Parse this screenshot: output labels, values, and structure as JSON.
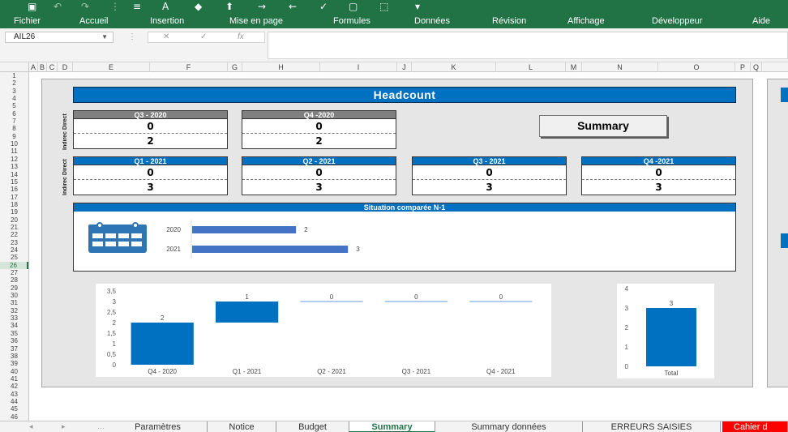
{
  "ribbon": {
    "menu": [
      "Fichier",
      "Accueil",
      "Insertion",
      "Mise en page",
      "Formules",
      "Données",
      "Révision",
      "Affichage",
      "Développeur",
      "Aide"
    ]
  },
  "formula_bar": {
    "name_box": "AIL26",
    "value": ""
  },
  "columns": [
    "A",
    "B",
    "C",
    "D",
    "E",
    "F",
    "G",
    "H",
    "I",
    "J",
    "K",
    "L",
    "M",
    "N",
    "O",
    "P",
    "Q"
  ],
  "rows": [
    "1",
    "2",
    "3",
    "4",
    "5",
    "6",
    "7",
    "8",
    "9",
    "10",
    "11",
    "12",
    "13",
    "14",
    "15",
    "16",
    "17",
    "18",
    "19",
    "20",
    "21",
    "22",
    "23",
    "24",
    "25",
    "26",
    "27",
    "28",
    "29",
    "30",
    "31",
    "32",
    "33",
    "34",
    "35",
    "36",
    "37",
    "38",
    "39",
    "40",
    "41",
    "42",
    "43",
    "44",
    "45",
    "46"
  ],
  "selected_row": "26",
  "dashboard": {
    "title": "Headcount",
    "vertical_label": "Indirec Direct",
    "summary_button": "Summary",
    "kpis_2020": [
      {
        "quarter": "Q3 - 2020",
        "top": "0",
        "bottom": "2"
      },
      {
        "quarter": "Q4 -2020",
        "top": "0",
        "bottom": "2"
      }
    ],
    "kpis_2021": [
      {
        "quarter": "Q1 - 2021",
        "top": "0",
        "bottom": "3"
      },
      {
        "quarter": "Q2 - 2021",
        "top": "0",
        "bottom": "3"
      },
      {
        "quarter": "Q3 - 2021",
        "top": "0",
        "bottom": "3"
      },
      {
        "quarter": "Q4 -2021",
        "top": "0",
        "bottom": "3"
      }
    ],
    "situation": {
      "title": "Situation comparée N-1",
      "rows": [
        {
          "label": "2020",
          "value": 2
        },
        {
          "label": "2021",
          "value": 3
        }
      ]
    }
  },
  "chart_data": [
    {
      "type": "bar",
      "chart_kind": "waterfall",
      "categories": [
        "Q4 - 2020",
        "Q1 - 2021",
        "Q2 - 2021",
        "Q3 - 2021",
        "Q4 - 2021"
      ],
      "values": [
        2,
        1,
        0,
        0,
        0
      ],
      "ylim": [
        0,
        3.5
      ],
      "yticks": [
        "0",
        "0,5",
        "1",
        "1,5",
        "2",
        "2,5",
        "3",
        "3,5"
      ],
      "grid": false
    },
    {
      "type": "bar",
      "categories": [
        "Total"
      ],
      "values": [
        3
      ],
      "ylim": [
        0,
        4
      ],
      "yticks": [
        "0",
        "1",
        "2",
        "3",
        "4"
      ],
      "grid": false
    }
  ],
  "tabs": [
    "Paramètres",
    "Notice",
    "Budget",
    "Summary",
    "Summary données",
    "ERREURS SAISIES",
    "Cahier d"
  ],
  "active_tab": "Summary",
  "colors": {
    "excel_green": "#217346",
    "accent_blue": "#0070c0",
    "header_gray": "#808080"
  }
}
